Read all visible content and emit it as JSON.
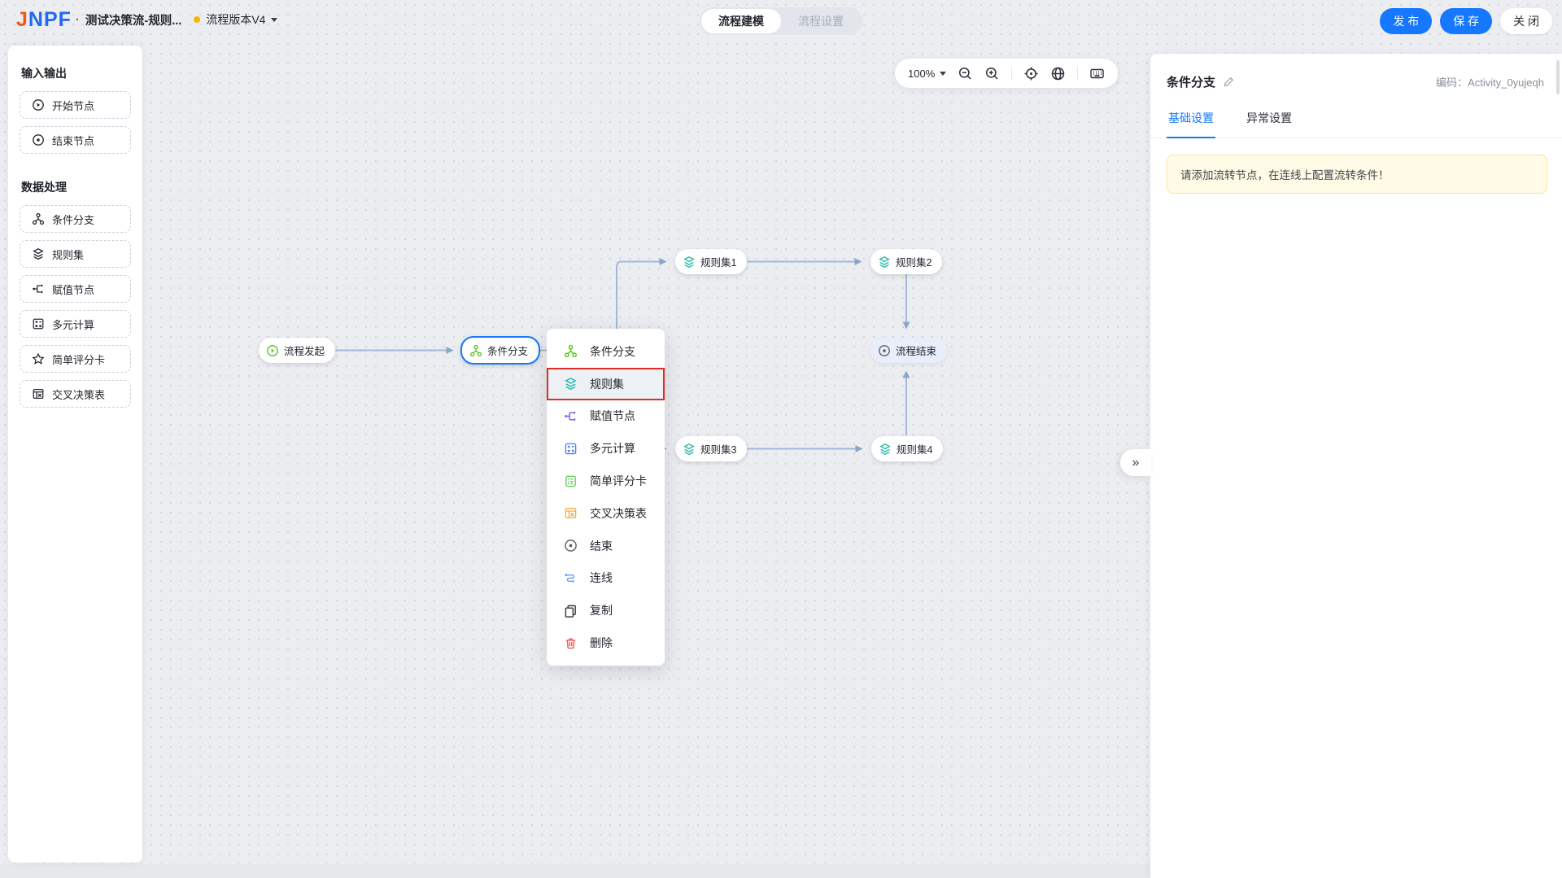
{
  "header": {
    "logo_j": "J",
    "logo_rest": "NPF",
    "separator": "·",
    "title": "测试决策流-规则...",
    "version_label": "流程版本V4",
    "mode_tabs": [
      {
        "label": "流程建模",
        "active": true
      },
      {
        "label": "流程设置",
        "active": false
      }
    ],
    "publish": "发 布",
    "save": "保 存",
    "close": "关 闭"
  },
  "sidebar": {
    "sections": [
      {
        "title": "输入输出",
        "items": [
          {
            "label": "开始节点",
            "icon": "play-circle-icon"
          },
          {
            "label": "结束节点",
            "icon": "circle-dot-icon"
          }
        ]
      },
      {
        "title": "数据处理",
        "items": [
          {
            "label": "条件分支",
            "icon": "branch-icon"
          },
          {
            "label": "规则集",
            "icon": "layers-icon"
          },
          {
            "label": "赋值节点",
            "icon": "assign-icon"
          },
          {
            "label": "多元计算",
            "icon": "calc-icon"
          },
          {
            "label": "简单评分卡",
            "icon": "star-icon"
          },
          {
            "label": "交叉决策表",
            "icon": "table-icon"
          }
        ]
      }
    ]
  },
  "canvas_toolbar": {
    "zoom_level": "100%"
  },
  "flow": {
    "nodes": [
      {
        "label": "流程发起",
        "icon": "play-circle-icon"
      },
      {
        "label": "条件分支",
        "icon": "branch-icon",
        "selected": true
      },
      {
        "label": "规则集1",
        "icon": "layers-icon"
      },
      {
        "label": "规则集2",
        "icon": "layers-icon"
      },
      {
        "label": "流程结束",
        "icon": "circle-dot-icon"
      },
      {
        "label": "规则集3",
        "icon": "layers-icon"
      },
      {
        "label": "规则集4",
        "icon": "layers-icon"
      }
    ],
    "context_menu": {
      "items": [
        {
          "label": "条件分支",
          "icon": "branch-icon"
        },
        {
          "label": "规则集",
          "icon": "layers-icon",
          "highlighted": true
        },
        {
          "label": "赋值节点",
          "icon": "assign-icon"
        },
        {
          "label": "多元计算",
          "icon": "calc-icon"
        },
        {
          "label": "简单评分卡",
          "icon": "scorecard-icon"
        },
        {
          "label": "交叉决策表",
          "icon": "table-icon"
        },
        {
          "label": "结束",
          "icon": "circle-dot-icon"
        },
        {
          "label": "连线",
          "icon": "connect-icon"
        },
        {
          "label": "复制",
          "icon": "copy-icon"
        },
        {
          "label": "删除",
          "icon": "trash-icon"
        }
      ]
    },
    "collapse_glyph": "»"
  },
  "panel": {
    "title": "条件分支",
    "code_label": "编码：",
    "code_value": "Activity_0yujeqh",
    "tabs": [
      {
        "label": "基础设置",
        "active": true
      },
      {
        "label": "异常设置",
        "active": false
      }
    ],
    "notice": "请添加流转节点，在连线上配置流转条件！"
  },
  "colors": {
    "accent": "#1677ff",
    "edge_line": "#a3b8d8",
    "highlight_border": "#e02b2b",
    "warning_bg": "#fffbe6",
    "warning_border": "#ffe58f",
    "version_dot": "#f7b500",
    "green": "#52c41a",
    "teal": "#23b7a9",
    "purple": "#7c5cf5",
    "blue": "#4a7df5",
    "yellow": "#f0b13f",
    "red": "#f25a5a"
  }
}
